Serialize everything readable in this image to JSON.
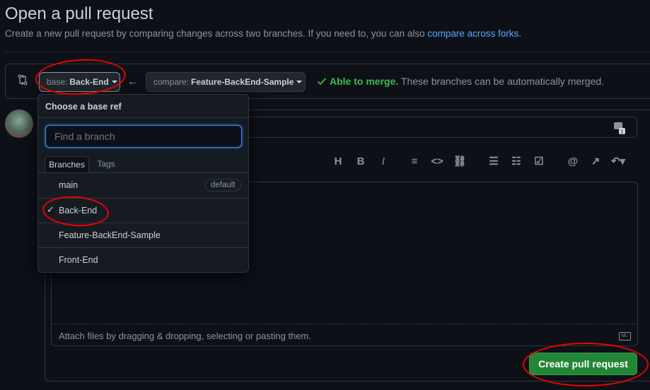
{
  "header": {
    "title": "Open a pull request",
    "subtitle": "Create a new pull request by comparing changes across two branches. If you need to, you can also",
    "subtitle_link": "compare across forks",
    "subtitle_end": "."
  },
  "compare_bar": {
    "base_prefix": "base:",
    "base_value": "Back-End",
    "compare_prefix": "compare:",
    "compare_value": "Feature-BackEnd-Sample",
    "merge_status": "Able to merge.",
    "merge_detail": "These branches can be automatically merged."
  },
  "dropdown": {
    "title": "Choose a base ref",
    "search_placeholder": "Find a branch",
    "tabs": [
      "Branches",
      "Tags"
    ],
    "items": [
      {
        "label": "main",
        "badge": "default",
        "selected": false
      },
      {
        "label": "Back-End",
        "selected": true
      },
      {
        "label": "Feature-BackEnd-Sample",
        "selected": false
      },
      {
        "label": "Front-End",
        "selected": false
      }
    ]
  },
  "editor": {
    "toolbar": [
      "heading-icon",
      "bold-icon",
      "italic-icon",
      "quote-icon",
      "code-icon",
      "link-icon",
      "unordered-list-icon",
      "ordered-list-icon",
      "task-list-icon",
      "mention-icon",
      "reference-icon",
      "undo-icon"
    ],
    "attach_text": "Attach files by dragging & dropping, selecting or pasting them.",
    "markdown_badge": "M↓"
  },
  "actions": {
    "create_label": "Create pull request"
  },
  "colors": {
    "background": "#0d1117",
    "accent_link": "#58a6ff",
    "success": "#3fb950",
    "primary_button": "#238636",
    "annotation": "#e00000"
  }
}
